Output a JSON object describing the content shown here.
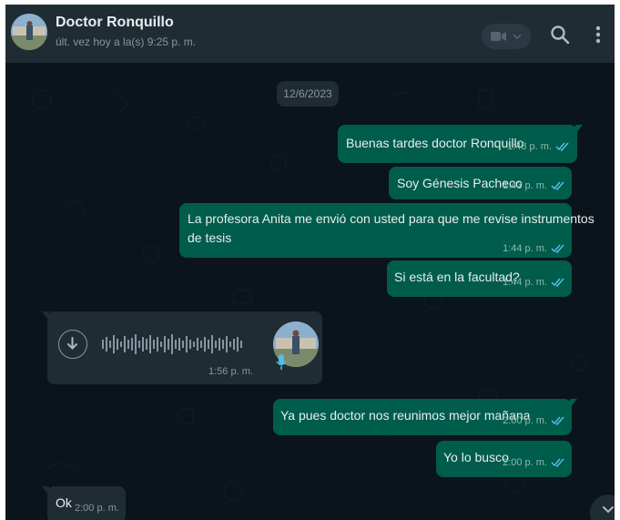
{
  "header": {
    "contact_name": "Doctor Ronquillo",
    "last_seen": "últ. vez hoy a la(s) 9:25 p. m.",
    "icons": [
      "video-call-icon",
      "chevron-down-icon",
      "search-icon",
      "menu-dots-icon"
    ]
  },
  "chat": {
    "date_chip": "12/6/2023",
    "messages": [
      {
        "direction": "out",
        "text": "Buenas tardes doctor Ronquillo",
        "time": "1:43 p. m.",
        "status": "read"
      },
      {
        "direction": "out",
        "text": "Soy Génesis Pacheco",
        "time": "1:43 p. m.",
        "status": "read"
      },
      {
        "direction": "out",
        "text_line1": "La profesora Anita me envió con usted para que me revise  instrumentos",
        "text_line2": "de tesis",
        "time": "1:44 p. m.",
        "status": "read"
      },
      {
        "direction": "out",
        "text": "Si está en la facultad?",
        "time": "1:44 p. m.",
        "status": "read"
      },
      {
        "direction": "in",
        "type": "voice",
        "time": "1:56 p. m.",
        "icons": [
          "download-icon",
          "microphone-icon"
        ]
      },
      {
        "direction": "out",
        "text": "Ya pues doctor nos reunimos mejor mañana",
        "time": "2:00 p. m.",
        "status": "read"
      },
      {
        "direction": "out",
        "text": "Yo lo busco",
        "time": "2:00 p. m.",
        "status": "read"
      },
      {
        "direction": "in",
        "text": "Ok",
        "time": "2:00 p. m."
      }
    ]
  },
  "scroll_button": {
    "icon": "chevron-down-icon"
  },
  "colors": {
    "header_bg": "#202c33",
    "chat_bg": "#0b141a",
    "outgoing_bubble": "#005c4b",
    "incoming_bubble": "#202c33",
    "read_tick": "#53bdeb"
  }
}
